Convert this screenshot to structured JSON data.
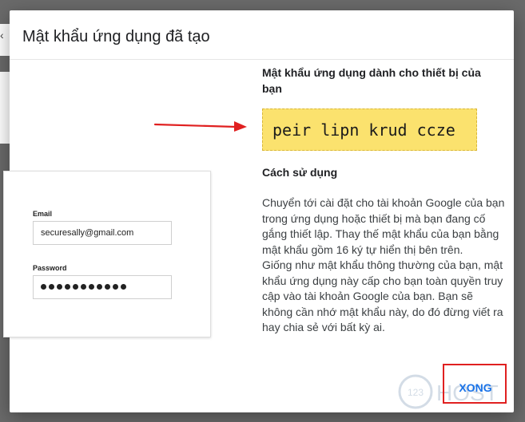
{
  "dialog": {
    "title": "Mật khẩu ứng dụng đã tạo",
    "subtitle": "Mật khẩu ứng dụng dành cho thiết bị của bạn",
    "generated_password": "peir lipn krud ccze",
    "howto_heading": "Cách sử dụng",
    "instructions": "Chuyển tới cài đặt cho tài khoản Google của bạn trong ứng dụng hoặc thiết bị mà bạn đang cố gắng thiết lập. Thay thế mật khẩu của bạn bằng mật khẩu gồm 16 ký tự hiển thị bên trên.\nGiống như mật khẩu thông thường của bạn, mật khẩu ứng dụng này cấp cho bạn toàn quyền truy cập vào tài khoản Google của bạn. Bạn sẽ không cần nhớ mật khẩu này, do đó đừng viết ra hay chia sẻ với bất kỳ ai.",
    "done_label": "XONG"
  },
  "mock_login": {
    "email_label": "Email",
    "email_value": "securesally@gmail.com",
    "password_label": "Password",
    "password_dot_count": 11
  },
  "watermark": {
    "badge_text": "123",
    "text": "HOST"
  },
  "colors": {
    "password_box": "#fbe26e",
    "accent": "#1a73e8",
    "annotation": "#e02020"
  }
}
